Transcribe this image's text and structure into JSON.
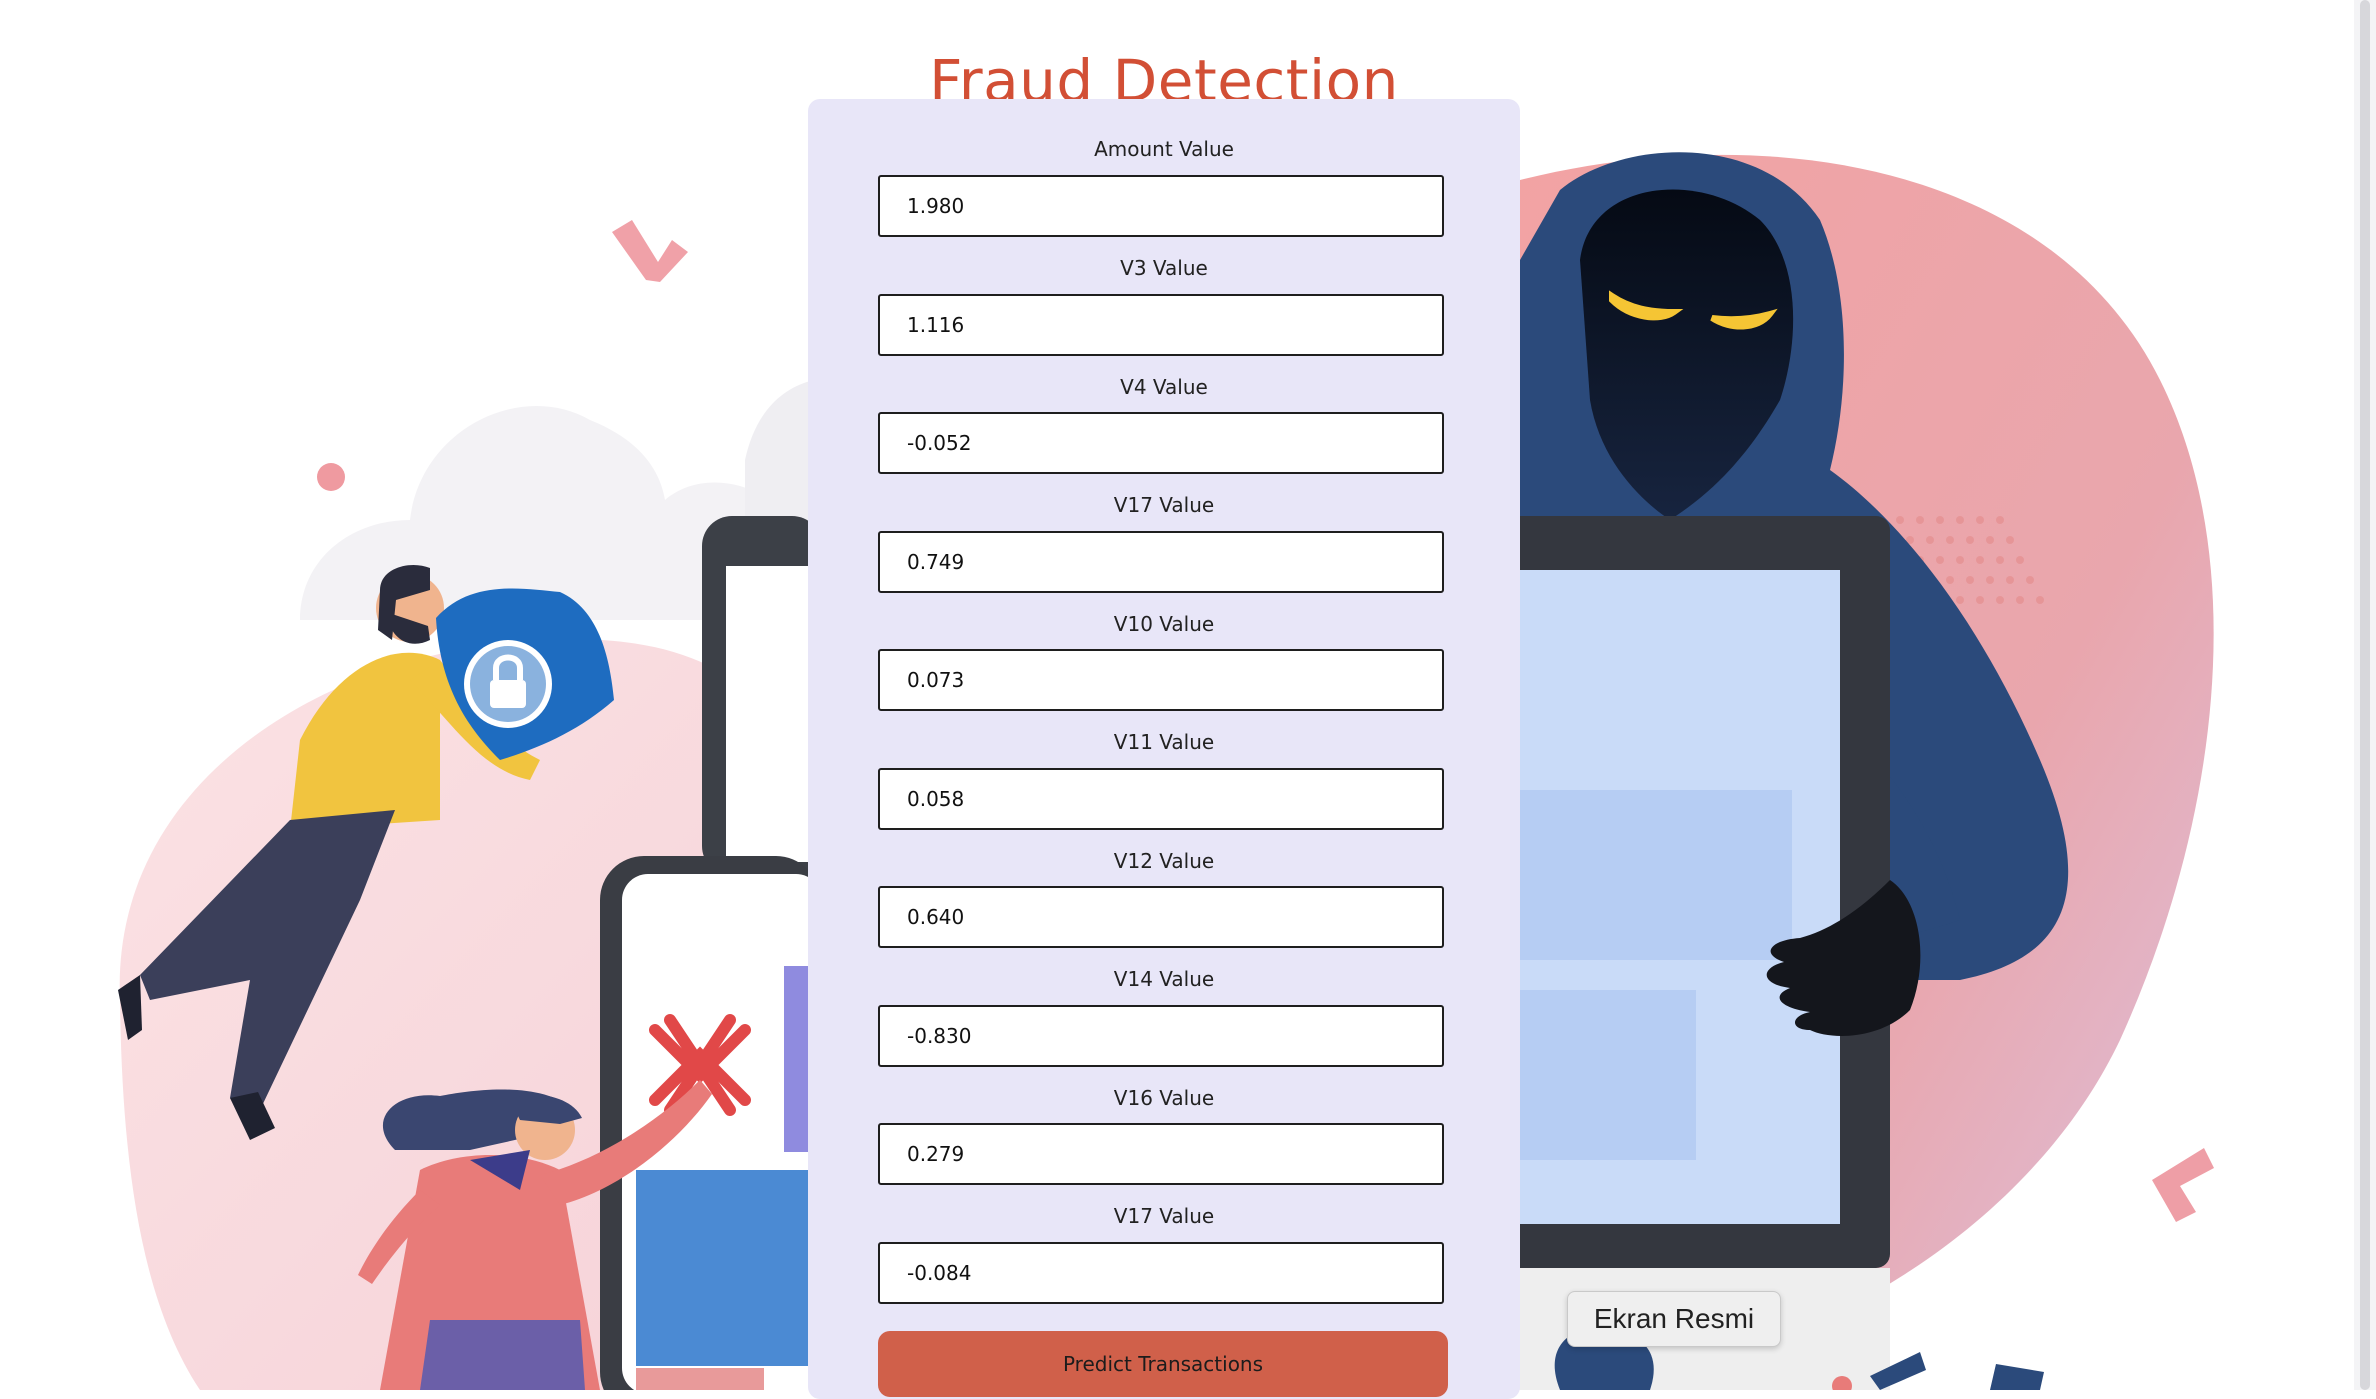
{
  "page": {
    "title": "Fraud Detection"
  },
  "form": {
    "fields": [
      {
        "label": "Amount Value",
        "value": "1.980"
      },
      {
        "label": "V3 Value",
        "value": "1.116"
      },
      {
        "label": "V4 Value",
        "value": "-0.052"
      },
      {
        "label": "V17 Value",
        "value": "0.749"
      },
      {
        "label": "V10 Value",
        "value": "0.073"
      },
      {
        "label": "V11 Value",
        "value": "0.058"
      },
      {
        "label": "V12 Value",
        "value": "0.640"
      },
      {
        "label": "V14 Value",
        "value": "-0.830"
      },
      {
        "label": "V16 Value",
        "value": "0.279"
      },
      {
        "label": "V17 Value",
        "value": "-0.084"
      }
    ],
    "submit_label": "Predict Transactions"
  },
  "tooltip": {
    "text": "Ekran Resmi"
  },
  "colors": {
    "title": "#d24f35",
    "panel": "#e8e6f8",
    "button": "#d0604a"
  }
}
